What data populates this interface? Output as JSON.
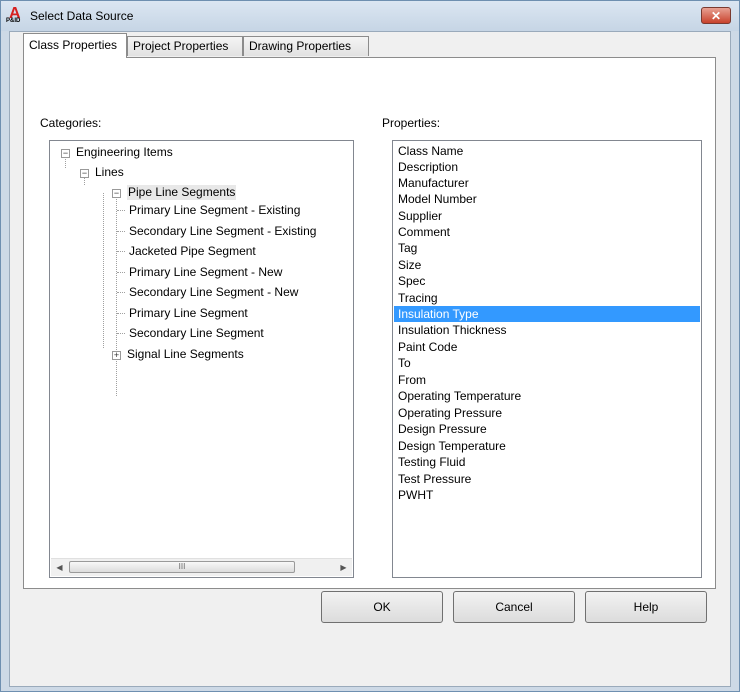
{
  "window": {
    "title": "Select Data Source",
    "app_icon_letter": "A",
    "app_icon_caption": "P&ID",
    "close_glyph": "✕"
  },
  "tabs": [
    {
      "label": "Class Properties",
      "active": true
    },
    {
      "label": "Project Properties",
      "active": false
    },
    {
      "label": "Drawing Properties",
      "active": false
    }
  ],
  "categories": {
    "label": "Categories:",
    "tree": [
      {
        "label": "Engineering Items",
        "level": 0,
        "expander": "−"
      },
      {
        "label": "Lines",
        "level": 1,
        "expander": "−"
      },
      {
        "label": "Pipe Line Segments",
        "level": 2,
        "expander": "−",
        "highlighted": true
      },
      {
        "label": "Primary Line Segment - Existing",
        "level": 3
      },
      {
        "label": "Secondary Line Segment - Existing",
        "level": 3
      },
      {
        "label": "Jacketed Pipe Segment",
        "level": 3
      },
      {
        "label": "Primary Line Segment - New",
        "level": 3
      },
      {
        "label": "Secondary Line Segment - New",
        "level": 3
      },
      {
        "label": "Primary Line Segment",
        "level": 3
      },
      {
        "label": "Secondary Line Segment",
        "level": 3
      },
      {
        "label": "Signal Line Segments",
        "level": 2,
        "expander": "+"
      }
    ],
    "scroll_left_glyph": "◀",
    "scroll_right_glyph": "▶",
    "scroll_thumb_grip": "III"
  },
  "properties": {
    "label": "Properties:",
    "items": [
      "Class Name",
      "Description",
      "Manufacturer",
      "Model Number",
      "Supplier",
      "Comment",
      "Tag",
      "Size",
      "Spec",
      "Tracing",
      "Insulation Type",
      "Insulation Thickness",
      "Paint Code",
      "To",
      "From",
      "Operating Temperature",
      "Operating Pressure",
      "Design Pressure",
      "Design Temperature",
      "Testing Fluid",
      "Test Pressure",
      "PWHT"
    ],
    "selected": "Insulation Type"
  },
  "buttons": {
    "ok": "OK",
    "cancel": "Cancel",
    "help": "Help"
  },
  "colors": {
    "selection": "#3399ff",
    "close_button": "#c8422c"
  }
}
